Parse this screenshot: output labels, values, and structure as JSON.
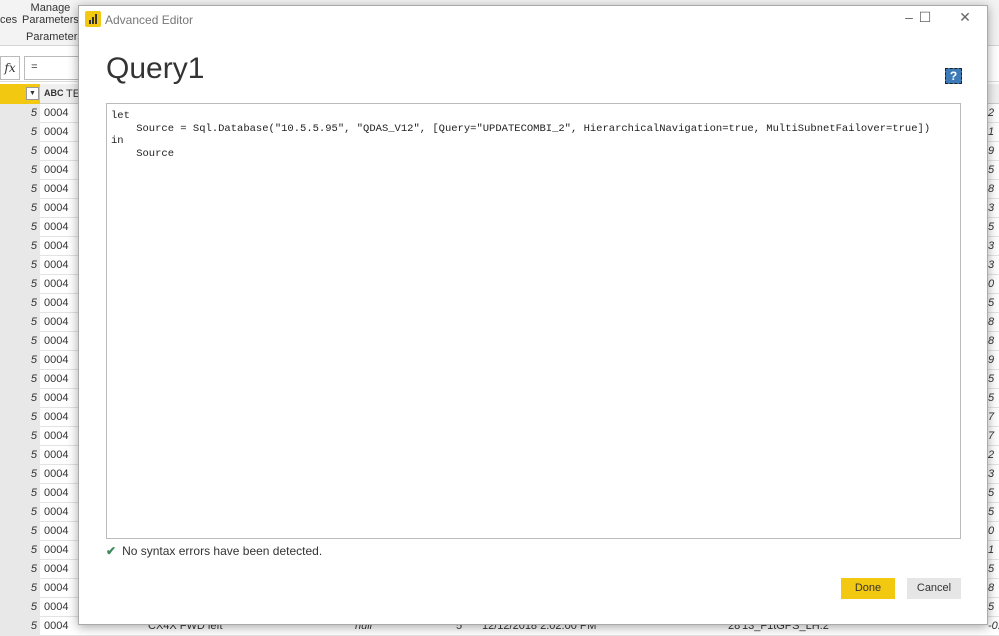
{
  "ribbon": {
    "item1": "ces",
    "manage_params": "Manage\nParameters",
    "params_group": "Parameters"
  },
  "formula": {
    "fx": "fx",
    "value": "= Sql.Da"
  },
  "grid": {
    "col_type_icon": "ABC",
    "col_header": "TE",
    "row_values": [
      "5",
      "5",
      "5",
      "5",
      "5",
      "5",
      "5",
      "5",
      "5",
      "5",
      "5",
      "5",
      "5",
      "5",
      "5",
      "5",
      "5",
      "5",
      "5",
      "5",
      "5",
      "5",
      "5",
      "5",
      "5",
      "5",
      "5",
      "5"
    ],
    "col1": "0004",
    "right_values": [
      "2",
      "1",
      "9",
      "5",
      "8",
      "3",
      "5",
      "3",
      "3",
      "0",
      "5",
      "8",
      "8",
      "9",
      "5",
      "5",
      "7",
      "7",
      "2",
      "3",
      "5",
      "5",
      "0",
      "1",
      "5",
      "8",
      "5",
      "-0.5"
    ],
    "last_row": {
      "name": "CX4X FWD left",
      "null": "null",
      "n": "5",
      "date": "12/12/2018 2:02:00 PM",
      "num": "28",
      "code": "13_F1tGPS_LH.2"
    }
  },
  "dialog": {
    "title": "Advanced Editor",
    "query_name": "Query1",
    "help_icon": "?",
    "code": "let\n    Source = Sql.Database(\"10.5.5.95\", \"QDAS_V12\", [Query=\"UPDATECOMBI_2\", HierarchicalNavigation=true, MultiSubnetFailover=true])\nin\n    Source",
    "status": "No syntax errors have been detected.",
    "done": "Done",
    "cancel": "Cancel"
  },
  "colors": {
    "accent": "#f2c811",
    "check": "#3c8a5c"
  }
}
